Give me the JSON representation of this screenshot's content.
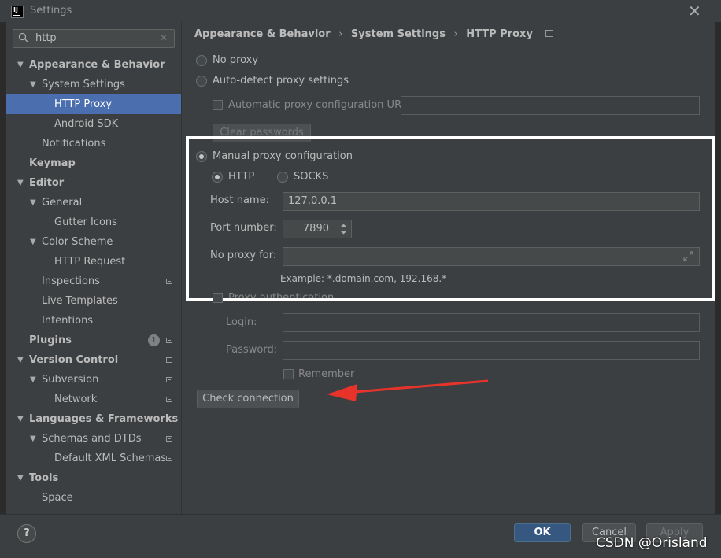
{
  "window": {
    "title": "Settings",
    "close_glyph": "✕"
  },
  "search": {
    "value": "http",
    "clear_glyph": "✕"
  },
  "tree": {
    "appearance_behavior": "Appearance & Behavior",
    "system_settings": "System Settings",
    "http_proxy": "HTTP Proxy",
    "android_sdk": "Android SDK",
    "notifications": "Notifications",
    "keymap": "Keymap",
    "editor": "Editor",
    "general": "General",
    "gutter_icons": "Gutter Icons",
    "color_scheme": "Color Scheme",
    "http_request": "HTTP Request",
    "inspections": "Inspections",
    "live_templates": "Live Templates",
    "intentions": "Intentions",
    "plugins": "Plugins",
    "plugins_badge": "1",
    "version_control": "Version Control",
    "subversion": "Subversion",
    "network": "Network",
    "languages_frameworks": "Languages & Frameworks",
    "schemas_dtds": "Schemas and DTDs",
    "default_xml_schemas": "Default XML Schemas",
    "tools": "Tools",
    "space": "Space"
  },
  "breadcrumb": [
    "Appearance & Behavior",
    "System Settings",
    "HTTP Proxy"
  ],
  "breadcrumb_sep": "›",
  "proxy": {
    "no_proxy": "No proxy",
    "auto_detect": "Auto-detect proxy settings",
    "auto_config_url": "Automatic proxy configuration URL:",
    "clear_passwords": "Clear passwords",
    "manual": "Manual proxy configuration",
    "http": "HTTP",
    "socks": "SOCKS",
    "host_label": "Host name:",
    "host_value": "127.0.0.1",
    "port_label": "Port number:",
    "port_value": "7890",
    "no_proxy_for_label": "No proxy for:",
    "no_proxy_for_value": "",
    "example": "Example: *.domain.com, 192.168.*",
    "proxy_auth": "Proxy authentication",
    "login_label": "Login:",
    "password_label": "Password:",
    "remember": "Remember",
    "check_connection": "Check connection"
  },
  "buttons": {
    "help": "?",
    "ok": "OK",
    "cancel": "Cancel",
    "apply": "Apply"
  },
  "watermark": "CSDN @Orisland",
  "colors": {
    "selection": "#4b6eaf",
    "annotation_arrow": "#e8332b",
    "highlight_box": "#ffffff"
  }
}
